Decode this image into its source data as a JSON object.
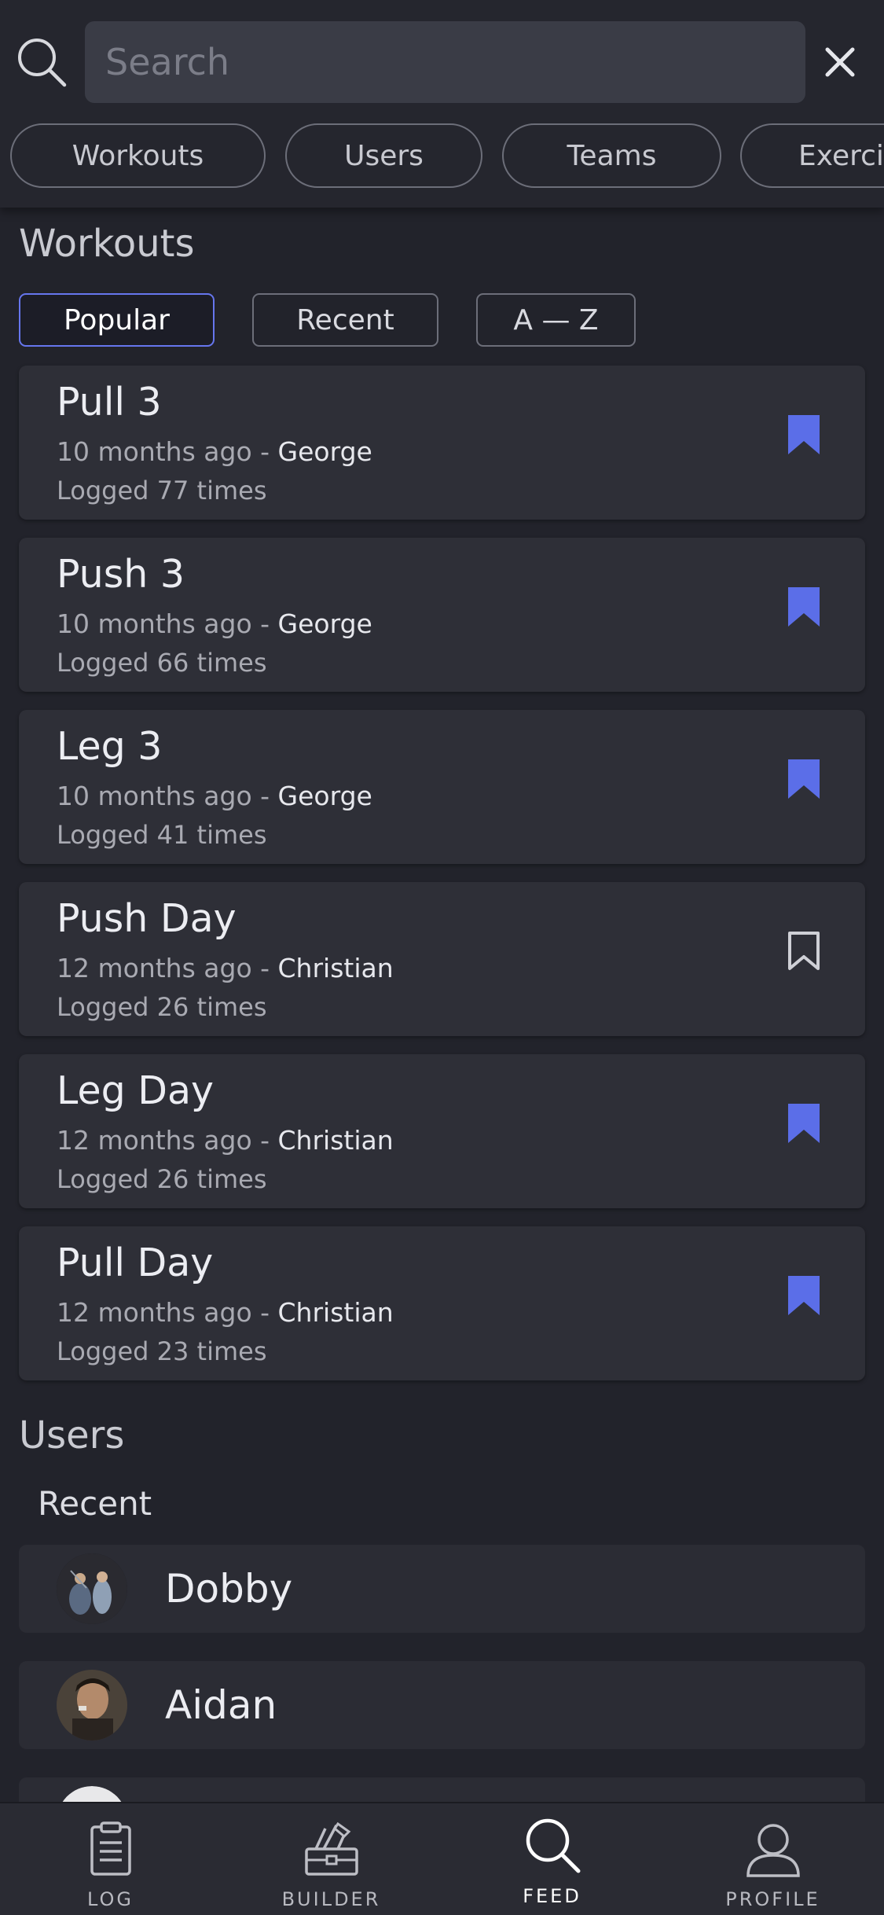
{
  "search": {
    "placeholder": "Search",
    "value": ""
  },
  "category_tabs": [
    "Workouts",
    "Users",
    "Teams",
    "Exercises"
  ],
  "workouts": {
    "title": "Workouts",
    "sort_options": [
      "Popular",
      "Recent",
      "A — Z"
    ],
    "active_sort": "Popular",
    "items": [
      {
        "name": "Pull 3",
        "age": "10 months ago - ",
        "author": "George",
        "logged": "Logged 77 times",
        "bookmarked": true
      },
      {
        "name": "Push 3",
        "age": "10 months ago - ",
        "author": "George",
        "logged": "Logged 66 times",
        "bookmarked": true
      },
      {
        "name": "Leg 3",
        "age": "10 months ago - ",
        "author": "George",
        "logged": "Logged 41 times",
        "bookmarked": true
      },
      {
        "name": "Push Day",
        "age": "12 months ago - ",
        "author": "Christian",
        "logged": "Logged 26 times",
        "bookmarked": false
      },
      {
        "name": "Leg Day",
        "age": "12 months ago - ",
        "author": "Christian",
        "logged": "Logged 26 times",
        "bookmarked": true
      },
      {
        "name": "Pull Day",
        "age": "12 months ago - ",
        "author": "Christian",
        "logged": "Logged 23 times",
        "bookmarked": true
      }
    ]
  },
  "users": {
    "title": "Users",
    "recent_label": "Recent",
    "items": [
      {
        "name": "Dobby"
      },
      {
        "name": "Aidan"
      },
      {
        "name": ""
      }
    ]
  },
  "bottom_nav": [
    {
      "label": "LOG",
      "icon": "clipboard-icon",
      "active": false
    },
    {
      "label": "BUILDER",
      "icon": "toolbox-icon",
      "active": false
    },
    {
      "label": "FEED",
      "icon": "search-icon",
      "active": true
    },
    {
      "label": "PROFILE",
      "icon": "user-icon",
      "active": false
    }
  ],
  "colors": {
    "background": "#22232b",
    "card": "#2e2f37",
    "accent": "#5b6ee8",
    "text": "#e9e9ee"
  }
}
